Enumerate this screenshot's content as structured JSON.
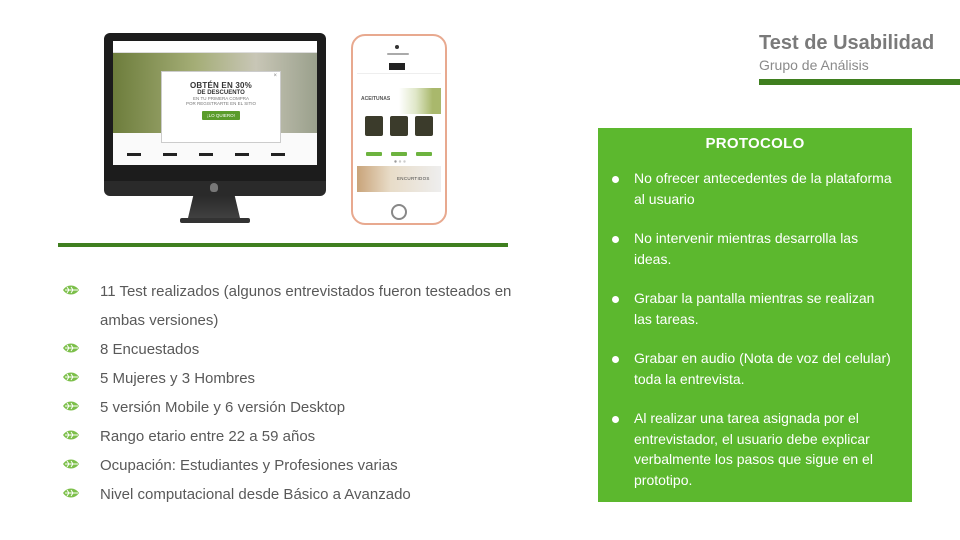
{
  "header": {
    "title": "Test de Usabilidad",
    "subtitle": "Grupo de Análisis"
  },
  "mockup": {
    "desktop": {
      "modal_line1": "OBTÉN EN 30%",
      "modal_line2": "DE DESCUENTO",
      "modal_line3": "EN TU PRIMERA COMPRA",
      "modal_line4": "POR REGISTRARTE EN EL SITIO",
      "modal_button": "¡LO QUIERO!"
    },
    "mobile": {
      "section1": "ACEITUNAS",
      "section2": "ENCURTIDOS"
    }
  },
  "bullets": [
    "11 Test realizados (algunos entrevistados fueron testeados en ambas versiones)",
    "8 Encuestados",
    "5 Mujeres y 3 Hombres",
    "5 versión Mobile y 6 versión Desktop",
    "Rango etario entre 22 a 59 años",
    "Ocupación: Estudiantes y Profesiones varias",
    "Nivel computacional desde Básico a Avanzado"
  ],
  "protocol": {
    "title": "PROTOCOLO",
    "items": [
      "No ofrecer antecedentes de la plataforma al usuario",
      "No intervenir mientras desarrolla las ideas.",
      "Grabar la pantalla mientras se realizan las tareas.",
      "Grabar en audio (Nota de voz del celular) toda la entrevista.",
      "Al realizar una tarea asignada por el entrevistador, el usuario debe explicar verbalmente los pasos que sigue en el prototipo."
    ]
  },
  "colors": {
    "accent_dark_green": "#3f7f1f",
    "protocol_green": "#5cb82e",
    "leaf_green": "#7cbf4a"
  },
  "icons": {
    "bullet": "leaf-icon",
    "protocol_bullet": "dot-icon"
  }
}
